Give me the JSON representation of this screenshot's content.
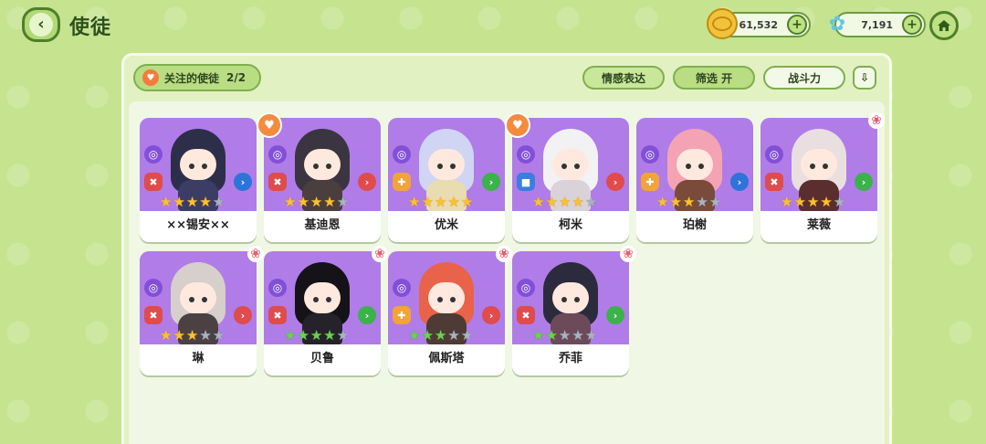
{
  "header": {
    "title": "使徒",
    "gold_amount": "61,532",
    "gem_amount": "7,191"
  },
  "toolbar": {
    "favorites_label": "关注的使徒",
    "favorites_count": "2/2",
    "emotion_label": "情感表达",
    "filter_label": "筛选 开",
    "power_label": "战斗力"
  },
  "characters": [
    {
      "name": "××锡安××",
      "favorite": false,
      "new": false,
      "role": "red",
      "speed": "blue",
      "stars": [
        "gold",
        "gold",
        "gold",
        "gold",
        "gray"
      ],
      "hair": "#2d2f4a",
      "outfit": "#3b3d64"
    },
    {
      "name": "基迪恩",
      "favorite": true,
      "new": false,
      "role": "red",
      "speed": "red",
      "stars": [
        "gold",
        "gold",
        "gold",
        "gold",
        "gray"
      ],
      "hair": "#3a3540",
      "outfit": "#4a3e3e"
    },
    {
      "name": "优米",
      "favorite": false,
      "new": false,
      "role": "orange",
      "speed": "green",
      "stars": [
        "gold",
        "gold",
        "gold",
        "gold",
        "gold"
      ],
      "hair": "#cfd5f3",
      "outfit": "#e8dcb0"
    },
    {
      "name": "柯米",
      "favorite": true,
      "new": false,
      "role": "blue",
      "speed": "red",
      "stars": [
        "gold",
        "gold",
        "gold",
        "gold",
        "gray"
      ],
      "hair": "#f2f1f3",
      "outfit": "#d9d3d9"
    },
    {
      "name": "珀榭",
      "favorite": false,
      "new": false,
      "role": "orange",
      "speed": "blue",
      "stars": [
        "gold",
        "gold",
        "gold",
        "gray",
        "gray"
      ],
      "hair": "#f4a3b4",
      "outfit": "#7a4a3a"
    },
    {
      "name": "莱薇",
      "favorite": false,
      "new": true,
      "role": "red",
      "speed": "green",
      "stars": [
        "gold",
        "gold",
        "gold",
        "gold",
        "gray"
      ],
      "hair": "#e9dfe0",
      "outfit": "#5a2e2e"
    },
    {
      "name": "琳",
      "favorite": false,
      "new": true,
      "role": "red",
      "speed": "red",
      "stars": [
        "gold",
        "gold",
        "gold",
        "gray",
        "gray"
      ],
      "hair": "#d6cfcb",
      "outfit": "#4b4143"
    },
    {
      "name": "贝鲁",
      "favorite": false,
      "new": true,
      "role": "red",
      "speed": "green",
      "stars": [
        "green",
        "green",
        "green",
        "green",
        "gray"
      ],
      "hair": "#151218",
      "outfit": "#26222a"
    },
    {
      "name": "佩斯塔",
      "favorite": false,
      "new": true,
      "role": "orange",
      "speed": "red",
      "stars": [
        "green",
        "green",
        "green",
        "gray",
        "gray"
      ],
      "hair": "#e8634a",
      "outfit": "#4e3b35"
    },
    {
      "name": "乔菲",
      "favorite": false,
      "new": true,
      "role": "red",
      "speed": "green",
      "stars": [
        "green",
        "green",
        "gray",
        "gray",
        "gray"
      ],
      "hair": "#2b2b3d",
      "outfit": "#6d4a5a"
    }
  ]
}
